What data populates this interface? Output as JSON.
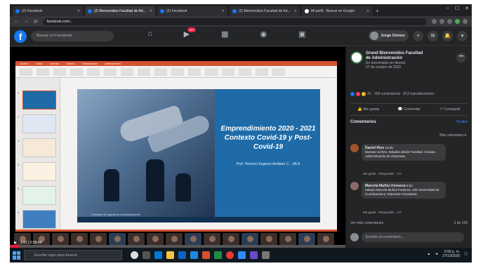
{
  "browser": {
    "tabs": [
      {
        "label": "(2) Facebook",
        "active": false
      },
      {
        "label": "(2) Bienvenidos Facultad de Ad...",
        "active": true
      },
      {
        "label": "(2) Facebook",
        "active": false
      },
      {
        "label": "(2) Bienvenidos Facultad de Ad...",
        "active": false
      },
      {
        "label": "Mi perfil - Buscar en Google",
        "active": false
      }
    ],
    "url": "facebook.com/..."
  },
  "facebook": {
    "search_placeholder": "Buscar en Facebook",
    "notification_badge": "20+",
    "user_name": "Jorge Gómez"
  },
  "slide": {
    "title_line1": "Emprendimiento 2020 - 2021",
    "title_line2": "Contexto Covid-19 y Post-",
    "title_line3": "Covid-19",
    "author": "Prof. Heinrich Eugenio Arellano C. - MLA",
    "footer": "Facultad de Ingeniería y Administración"
  },
  "video": {
    "time": "1:47 / 2:05:44"
  },
  "post": {
    "page_name": "Grand Bienvenidos Facultad de Administración",
    "meta_line": "En transmisión en directo",
    "date": "27 de octubre de 2020",
    "reactions_text": "31 · 150 comentarios · 813 reproducciones",
    "like": "Me gusta",
    "comment": "Comentar",
    "share": "Compartir",
    "comments_heading": "Comentarios",
    "comments_hide": "Ocultar",
    "relevance": "Más relevantes",
    "comments": [
      {
        "author": "Daniel Ríos",
        "time": "10:36",
        "text": "Buenas noches, Saludos desde Facultad. Gracias. Administración de empresas."
      },
      {
        "author": "Marcela Muñoz Fonseca",
        "time": "0:50",
        "text": "Saludo Marcela Muñoz Fonseca. 100 Universidad de Cundinamarca. Extensión Facatativá."
      }
    ],
    "comment_actions": "Me gusta · Responder · 2 h",
    "more_comments": "Ver más comentarios",
    "comment_count": "2 de 150",
    "write_placeholder": "Escribe un comentario..."
  },
  "taskbar": {
    "search_placeholder": "Escribe aquí para buscar",
    "time": "6:56 p. m.",
    "date": "27/10/2020"
  }
}
